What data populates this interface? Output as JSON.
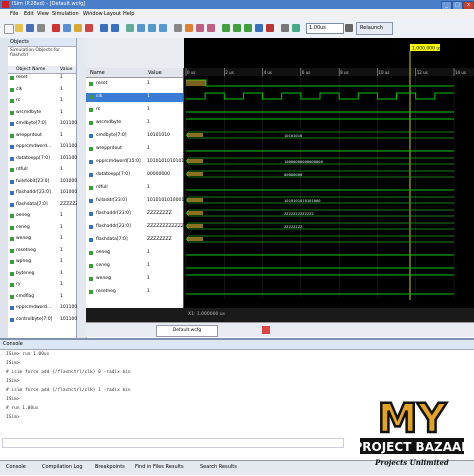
{
  "window": {
    "title": "ISim (P.28xd) - [Default.wcfg]",
    "min": "_",
    "max": "□",
    "close": "x"
  },
  "menu": [
    "File",
    "Edit",
    "View",
    "Simulation",
    "Window",
    "Layout",
    "Help"
  ],
  "toolbar": {
    "time_value": "1.00us",
    "relaunch": "Relaunch"
  },
  "objects_panel": {
    "title": "Objects",
    "subtitle": "Simulation Objects for flashctrl",
    "col_name": "Object Name",
    "col_value": "Value",
    "rows": [
      {
        "name": "reset",
        "value": "1"
      },
      {
        "name": "clk",
        "value": "1"
      },
      {
        "name": "rc",
        "value": "1"
      },
      {
        "name": "wrcmdbyte",
        "value": "1"
      },
      {
        "name": "cmdbyte[7:0]",
        "value": "101100"
      },
      {
        "name": "wrepprdout",
        "value": "1"
      },
      {
        "name": "epprcmdword...",
        "value": "101100"
      },
      {
        "name": "datatoepp[7:0]",
        "value": "101100"
      },
      {
        "name": "rdfull",
        "value": "1"
      },
      {
        "name": "fullstobit[23:0]",
        "value": "101000"
      },
      {
        "name": "flashaddr[23:0]",
        "value": "101000"
      },
      {
        "name": "flashdata[7:0]",
        "value": "ZZZZZZ"
      },
      {
        "name": "oeneg",
        "value": "1"
      },
      {
        "name": "ceneg",
        "value": "1"
      },
      {
        "name": "weneg",
        "value": "1"
      },
      {
        "name": "resetneg",
        "value": "1"
      },
      {
        "name": "wpneg",
        "value": "1"
      },
      {
        "name": "byteneg",
        "value": "1"
      },
      {
        "name": "ry",
        "value": "1"
      },
      {
        "name": "cmdflag",
        "value": "1"
      },
      {
        "name": "epprcmdword...",
        "value": "101100"
      },
      {
        "name": "controlbyte[7:0]",
        "value": "101100"
      }
    ]
  },
  "wave_panel": {
    "col_name": "Name",
    "col_value": "Value",
    "cursor_time": "1,000,000 us",
    "signals": [
      {
        "name": "reset",
        "value": "1"
      },
      {
        "name": "clk",
        "value": "1"
      },
      {
        "name": "rc",
        "value": "1"
      },
      {
        "name": "wrcmdbyte",
        "value": "1"
      },
      {
        "name": "cmdbyte[7:0]",
        "value": "10101010"
      },
      {
        "name": "wrepprdout",
        "value": "1"
      },
      {
        "name": "epprcmdword[15:0]",
        "value": "1010101010101010"
      },
      {
        "name": "datatoepp[7:0]",
        "value": "00000000"
      },
      {
        "name": "rdfull",
        "value": "1"
      },
      {
        "name": "fulladdr[23:0]",
        "value": "101010101000100"
      },
      {
        "name": "flashaddr[23:0]",
        "value": "ZZZZZZZZ"
      },
      {
        "name": "flashaddr[23:0]",
        "value": "ZZZZZZZZZZZZZZZZ"
      },
      {
        "name": "flashdata[7:0]",
        "value": "ZZZZZZZZ"
      },
      {
        "name": "oeneg",
        "value": "1"
      },
      {
        "name": "ceneg",
        "value": "1"
      },
      {
        "name": "weneg",
        "value": "1"
      },
      {
        "name": "resetneg",
        "value": "1"
      }
    ],
    "time_ticks": [
      "0 us",
      "2 us",
      "4 us",
      "6 us",
      "8 us",
      "10 us",
      "12 us",
      "14 us"
    ],
    "bus_labels": [
      "10101010",
      "10000000000000000",
      "00000000",
      "1010101010101000",
      "ZZZZZZZZZZZZZ",
      "ZZZZZZZZ"
    ],
    "status_time": "X1: 1.000000 us",
    "tab_label": "Default.wcfg"
  },
  "console": {
    "title": "Console",
    "lines": [
      "ISim> run 1.00us",
      "ISim>",
      "# isim force add {/flashctrl/clk} 0 -radix bin",
      "ISim>",
      "# isim force add {/flashctrl/clk} 1 -radix bin",
      "ISim>",
      "# run 1.00us",
      "ISim>"
    ],
    "tabs": [
      "Console",
      "Compilation Log",
      "Breakpoints",
      "Find in Files Results",
      "Search Results"
    ]
  },
  "logo": {
    "top": "MY",
    "main": "PROJECT BAZAAR",
    "tagline": "Projects Unlimited"
  },
  "colors": {
    "wave_green": "#00c800",
    "bus_green": "#1fa31f",
    "cursor_yellow": "#ffff00",
    "selection_blue": "#3a7bd5"
  }
}
